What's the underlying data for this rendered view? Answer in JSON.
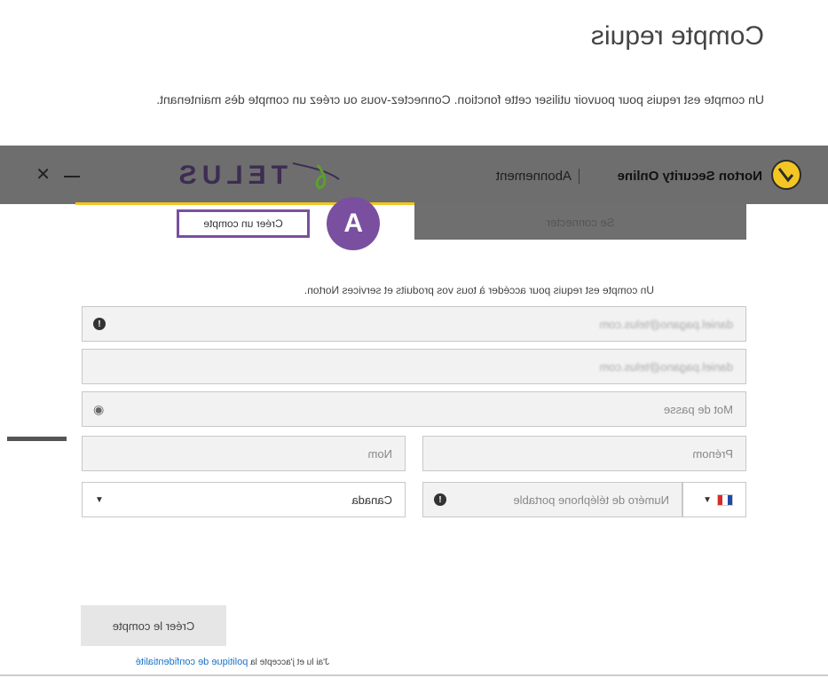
{
  "page": {
    "title": "Compte requis",
    "intro": "Un compte est requis pour pouvoir utiliser cette fonction. Connectez-vous ou créez un compte dès maintenant."
  },
  "topbar": {
    "brand_name": "Norton Security Online",
    "subscription": "Abonnement",
    "partner": "TELUS",
    "brand_color": "#f3c623"
  },
  "tabs": {
    "signin": "Se connecter",
    "create": "Créer un compte"
  },
  "callout": {
    "label": "A",
    "color": "#7a4fa0"
  },
  "form": {
    "note": "Un compte est requis pour accéder à tous vos produits et services Norton.",
    "email_value": "daniel.pagano@telus.com",
    "email_confirm_value": "daniel.pagano@telus.com",
    "password_placeholder": "Mot de passe",
    "firstname_placeholder": "Prénom",
    "lastname_placeholder": "Nom",
    "phone_placeholder": "Numéro de téléphone portable",
    "country": "Canada",
    "submit": "Créer le compte",
    "legal_prefix": "J'ai lu et j'accepte la",
    "legal_link": "politique de confidentialité"
  }
}
